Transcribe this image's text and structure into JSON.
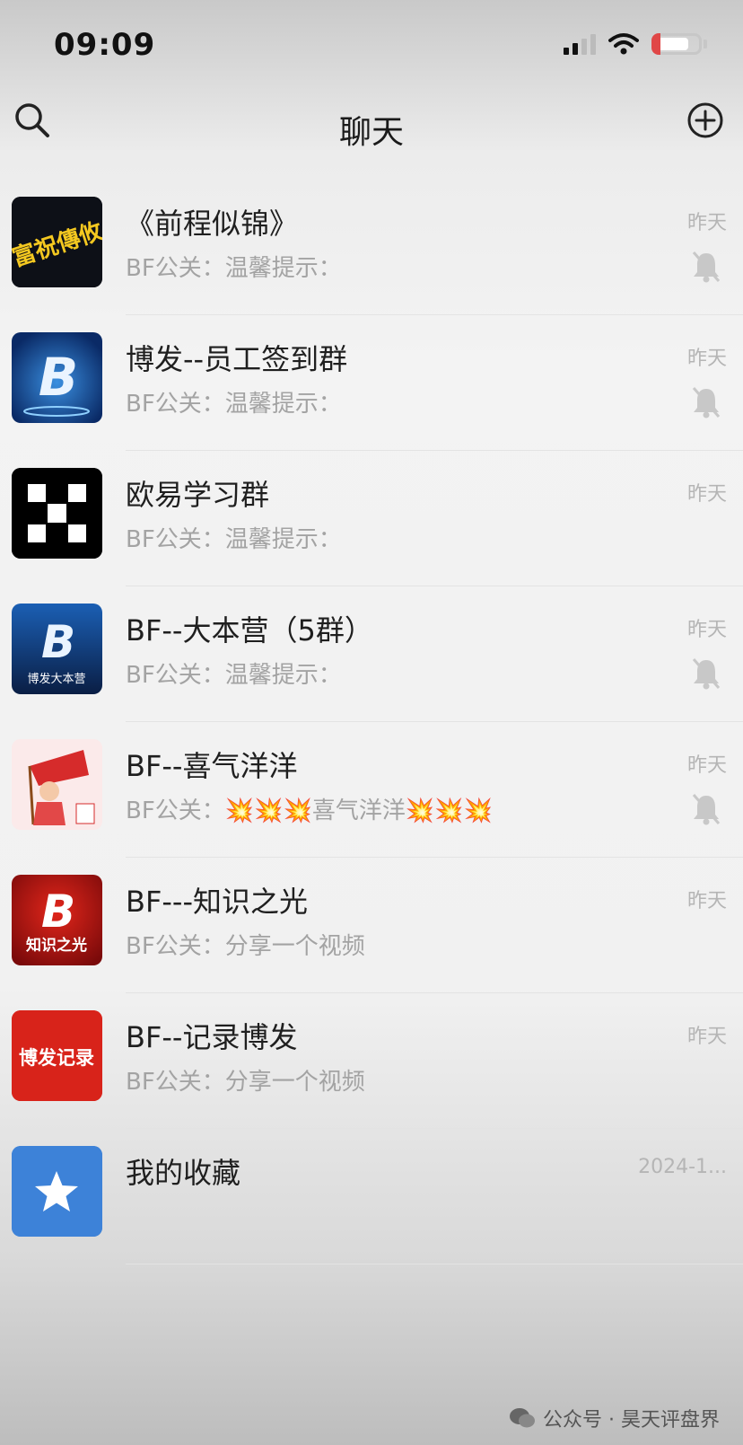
{
  "status": {
    "time": "09:09"
  },
  "header": {
    "title": "聊天",
    "search_icon": "search-icon",
    "add_icon": "plus-circle-icon"
  },
  "chats": [
    {
      "name": "《前程似锦》",
      "preview": "BF公关：温馨提示：",
      "time": "昨天",
      "muted": true,
      "avatar": "avatar-image"
    },
    {
      "name": "博发--员工签到群",
      "preview": "BF公关：温馨提示：",
      "time": "昨天",
      "muted": true,
      "avatar": "avatar-image"
    },
    {
      "name": "欧易学习群",
      "preview": "BF公关：温馨提示：",
      "time": "昨天",
      "muted": false,
      "avatar": "avatar-image"
    },
    {
      "name": "BF--大本营（5群）",
      "preview": "BF公关：温馨提示：",
      "time": "昨天",
      "muted": true,
      "avatar": "avatar-image"
    },
    {
      "name": "BF--喜气洋洋",
      "preview": "BF公关：💥💥💥喜气洋洋💥💥💥",
      "time": "昨天",
      "muted": true,
      "avatar": "avatar-image"
    },
    {
      "name": "BF---知识之光",
      "preview": "BF公关：分享一个视频",
      "time": "昨天",
      "muted": false,
      "avatar": "avatar-image"
    },
    {
      "name": "BF--记录博发",
      "preview": "BF公关：分享一个视频",
      "time": "昨天",
      "muted": false,
      "avatar": "avatar-image"
    },
    {
      "name": "我的收藏",
      "preview": "",
      "time": "2024-1...",
      "muted": false,
      "avatar": "star-icon"
    }
  ],
  "avatar_text": {
    "a1": "富祝傳攸",
    "a4": "博发大本营",
    "a6": "知识之光",
    "a7": "博发记录"
  },
  "watermark": {
    "text": "公众号 · 昊天评盘界"
  }
}
